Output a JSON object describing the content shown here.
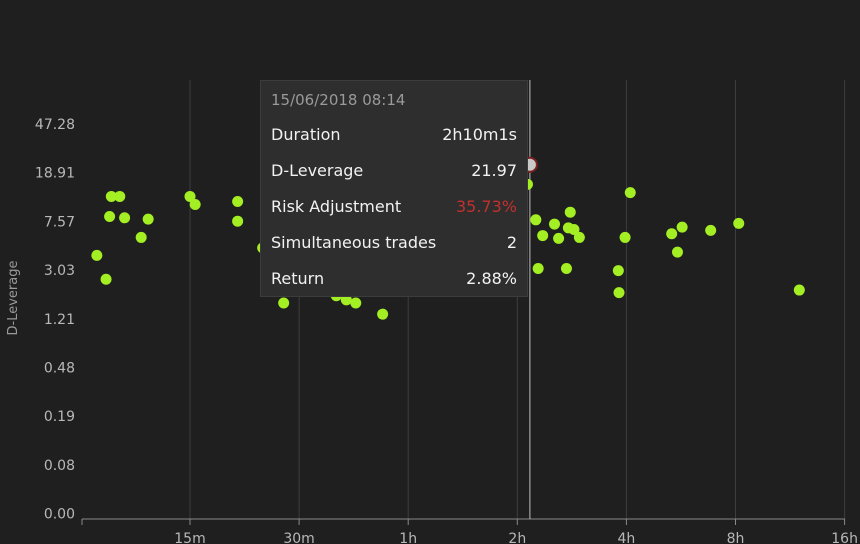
{
  "chart_data": {
    "type": "scatter",
    "xlabel": "",
    "ylabel": "D-Leverage",
    "x_ticks": [
      "15m",
      "30m",
      "1h",
      "2h",
      "4h",
      "8h",
      "16h"
    ],
    "x_tick_minutes": [
      15,
      30,
      60,
      120,
      240,
      480,
      960
    ],
    "y_ticks": [
      "0.00",
      "0.08",
      "0.19",
      "0.48",
      "1.21",
      "3.03",
      "7.57",
      "18.91",
      "47.28"
    ],
    "y_tick_values": [
      0,
      0.08,
      0.19,
      0.48,
      1.21,
      3.03,
      7.57,
      18.91,
      47.28
    ],
    "xlim_minutes": [
      7,
      1000
    ],
    "marker_color": "#a4ef23",
    "highlight_color": "#c9c9c9",
    "highlight": {
      "duration_minutes": 130,
      "d_leverage": 21.97
    },
    "series": [
      {
        "points": [
          {
            "x": 8.3,
            "y": 4.0
          },
          {
            "x": 8.8,
            "y": 2.55
          },
          {
            "x": 9.0,
            "y": 8.3
          },
          {
            "x": 9.1,
            "y": 12.1
          },
          {
            "x": 9.6,
            "y": 12.1
          },
          {
            "x": 9.9,
            "y": 8.1
          },
          {
            "x": 11.0,
            "y": 5.6
          },
          {
            "x": 11.5,
            "y": 7.9
          },
          {
            "x": 15.0,
            "y": 12.1
          },
          {
            "x": 15.5,
            "y": 10.4
          },
          {
            "x": 20.3,
            "y": 11.0
          },
          {
            "x": 20.3,
            "y": 7.6
          },
          {
            "x": 23.8,
            "y": 4.6
          },
          {
            "x": 27.2,
            "y": 1.63
          },
          {
            "x": 38.0,
            "y": 1.87
          },
          {
            "x": 40.5,
            "y": 1.73
          },
          {
            "x": 43.0,
            "y": 1.63
          },
          {
            "x": 51.0,
            "y": 1.32
          },
          {
            "x": 128.0,
            "y": 15.2
          },
          {
            "x": 135.0,
            "y": 7.8
          },
          {
            "x": 137.0,
            "y": 3.12
          },
          {
            "x": 141.0,
            "y": 5.8
          },
          {
            "x": 152.0,
            "y": 7.2
          },
          {
            "x": 156.0,
            "y": 5.5
          },
          {
            "x": 164.0,
            "y": 3.12
          },
          {
            "x": 166.0,
            "y": 6.7
          },
          {
            "x": 168.0,
            "y": 9.0
          },
          {
            "x": 172.0,
            "y": 6.5
          },
          {
            "x": 178.0,
            "y": 5.6
          },
          {
            "x": 228.0,
            "y": 3.0
          },
          {
            "x": 229.0,
            "y": 1.98
          },
          {
            "x": 238.0,
            "y": 5.6
          },
          {
            "x": 246.0,
            "y": 13.0
          },
          {
            "x": 320.0,
            "y": 6.0
          },
          {
            "x": 332.0,
            "y": 4.25
          },
          {
            "x": 342.0,
            "y": 6.8
          },
          {
            "x": 410.0,
            "y": 6.4
          },
          {
            "x": 490.0,
            "y": 7.3
          },
          {
            "x": 720.0,
            "y": 2.08
          }
        ]
      }
    ]
  },
  "tooltip": {
    "timestamp": "15/06/2018 08:14",
    "rows": [
      {
        "label": "Duration",
        "value": "2h10m1s"
      },
      {
        "label": "D-Leverage",
        "value": "21.97"
      },
      {
        "label": "Risk Adjustment",
        "value": "35.73%"
      },
      {
        "label": "Simultaneous trades",
        "value": "2"
      },
      {
        "label": "Return",
        "value": "2.88%"
      }
    ]
  },
  "colors": {
    "background": "#1f1f1f",
    "grid": "#3e3e3e",
    "tooltip_bg": "#2e2e2e",
    "negative_text": "#c0312d"
  }
}
